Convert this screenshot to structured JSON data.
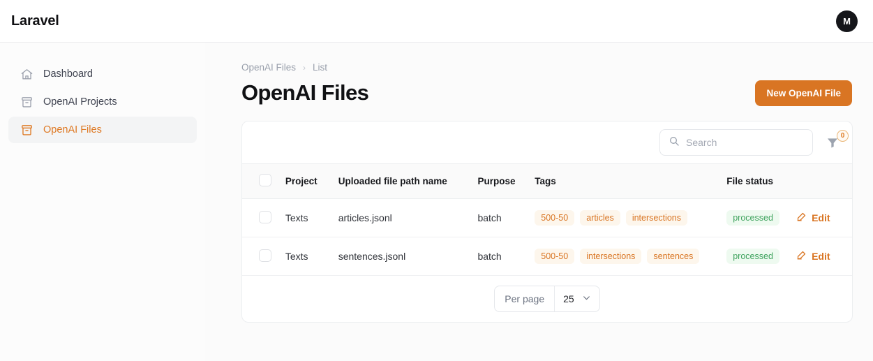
{
  "topbar": {
    "brand": "Laravel",
    "avatar_initial": "M"
  },
  "sidebar": {
    "items": [
      {
        "label": "Dashboard",
        "icon": "home-icon",
        "active": false
      },
      {
        "label": "OpenAI Projects",
        "icon": "archive-box-icon",
        "active": false
      },
      {
        "label": "OpenAI Files",
        "icon": "archive-box-icon",
        "active": true
      }
    ]
  },
  "breadcrumb": {
    "root": "OpenAI Files",
    "separator": "›",
    "current": "List"
  },
  "header": {
    "title": "OpenAI Files",
    "new_button": "New OpenAI File"
  },
  "toolbar": {
    "search_placeholder": "Search",
    "search_value": "",
    "filter_count": "0"
  },
  "table": {
    "columns": [
      "Project",
      "Uploaded file path name",
      "Purpose",
      "Tags",
      "File status"
    ],
    "rows": [
      {
        "project": "Texts",
        "path": "articles.jsonl",
        "purpose": "batch",
        "tags": [
          "500-50",
          "articles",
          "intersections"
        ],
        "status": "processed",
        "action": "Edit"
      },
      {
        "project": "Texts",
        "path": "sentences.jsonl",
        "purpose": "batch",
        "tags": [
          "500-50",
          "intersections",
          "sentences"
        ],
        "status": "processed",
        "action": "Edit"
      }
    ]
  },
  "footer": {
    "per_page_label": "Per page",
    "per_page_value": "25"
  },
  "colors": {
    "accent": "#d97523",
    "status_green": "#3fa35e",
    "tag_bg": "#fdf6ec"
  }
}
